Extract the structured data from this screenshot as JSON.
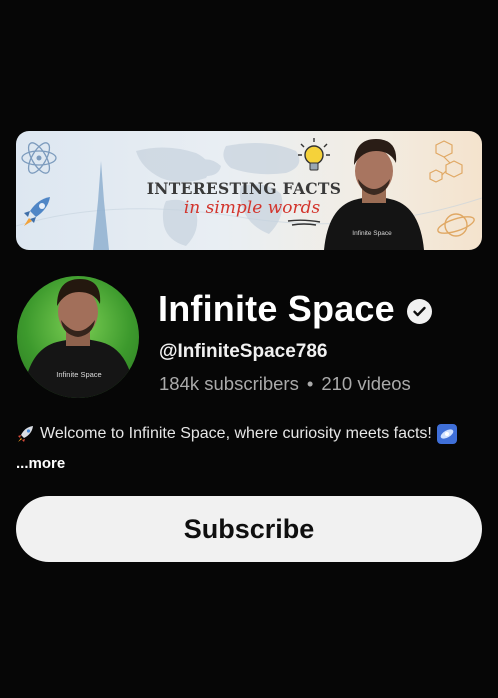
{
  "banner": {
    "title": "INTERESTING FACTS",
    "subtitle": "in simple words",
    "hoodie_text": "Infinite Space"
  },
  "channel": {
    "name": "Infinite Space",
    "handle": "@InfiniteSpace786",
    "subscribers": "184k subscribers",
    "separator": "•",
    "videos": "210 videos",
    "avatar_hoodie_text": "Infinite Space"
  },
  "description": {
    "text": "Welcome to Infinite Space, where curiosity meets facts!",
    "leading_icon": "rocket-icon",
    "trailing_icon": "galaxy-icon",
    "more_label": "...more"
  },
  "actions": {
    "subscribe_label": "Subscribe"
  },
  "colors": {
    "background": "#060606",
    "subscribe_bg": "#f1f1f1",
    "subscribe_text": "#0f0f0f",
    "secondary_text": "#aaaaaa",
    "banner_accent": "#d3342c"
  }
}
